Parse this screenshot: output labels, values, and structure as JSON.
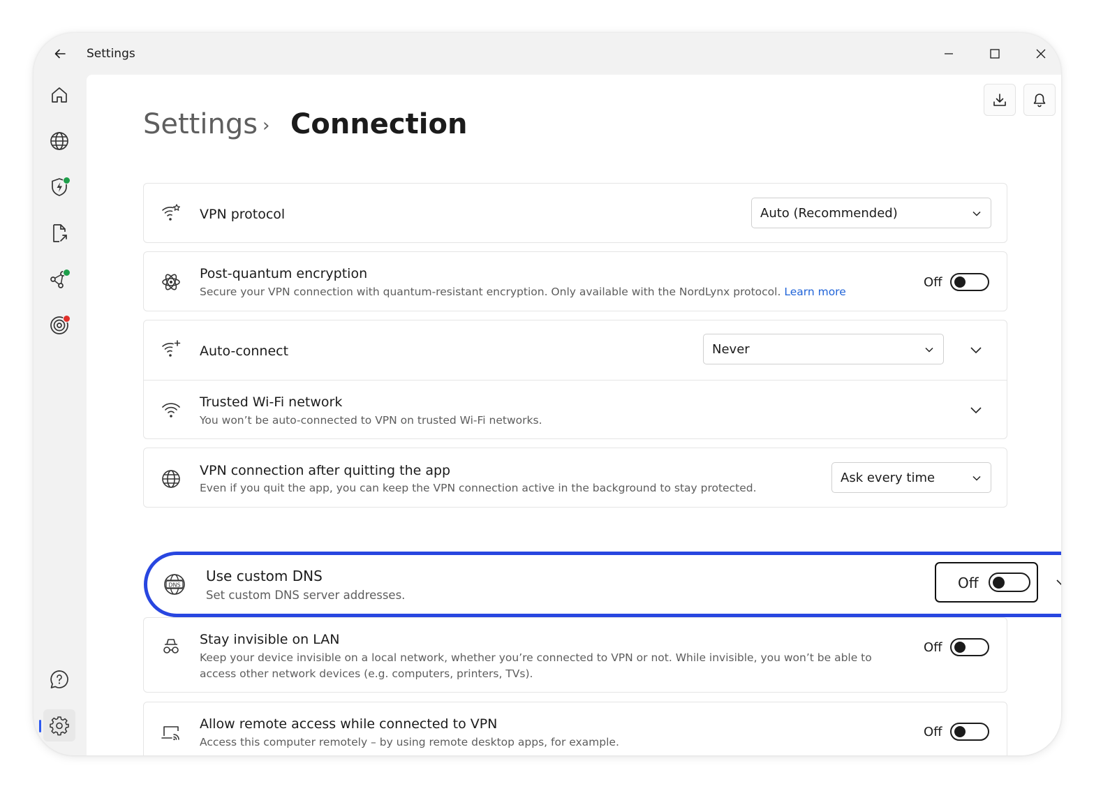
{
  "titlebar": {
    "title": "Settings"
  },
  "breadcrumb": {
    "root": "Settings",
    "separator": "›",
    "current": "Connection"
  },
  "settings": {
    "vpn_protocol": {
      "title": "VPN protocol",
      "value": "Auto (Recommended)"
    },
    "post_quantum": {
      "title": "Post-quantum encryption",
      "description": "Secure your VPN connection with quantum-resistant encryption. Only available with the NordLynx protocol.",
      "link": "Learn more",
      "state": "Off"
    },
    "auto_connect": {
      "title": "Auto-connect",
      "value": "Never"
    },
    "trusted_wifi": {
      "title": "Trusted Wi-Fi network",
      "description": "You won’t be auto-connected to VPN on trusted Wi-Fi networks."
    },
    "vpn_after_quit": {
      "title": "VPN connection after quitting the app",
      "description": "Even if you quit the app, you can keep the VPN connection active in the background to stay protected.",
      "value": "Ask every time"
    },
    "custom_dns": {
      "title": "Use custom DNS",
      "description": "Set custom DNS server addresses.",
      "state": "Off"
    },
    "invisible_lan": {
      "title": "Stay invisible on LAN",
      "description_line1": "Keep your device invisible on a local network, whether you’re connected to VPN or not. While invisible, you won’t be able to",
      "description_line2": "access other network devices (e.g. computers, printers, TVs).",
      "state": "Off"
    },
    "remote_access": {
      "title": "Allow remote access while connected to VPN",
      "description": "Access this computer remotely – by using remote desktop apps, for example.",
      "state": "Off"
    }
  },
  "colors": {
    "accent": "#2846e0",
    "link": "#1f63d8",
    "status_green": "#1e9e4a",
    "status_red": "#e0302a"
  },
  "icons": [
    "back-arrow-icon",
    "minimize-icon",
    "maximize-icon",
    "close-icon",
    "home-icon",
    "globe-icon",
    "shield-bolt-icon",
    "file-share-icon",
    "meshnet-icon",
    "target-icon",
    "help-icon",
    "gear-icon",
    "download-icon",
    "bell-icon"
  ]
}
